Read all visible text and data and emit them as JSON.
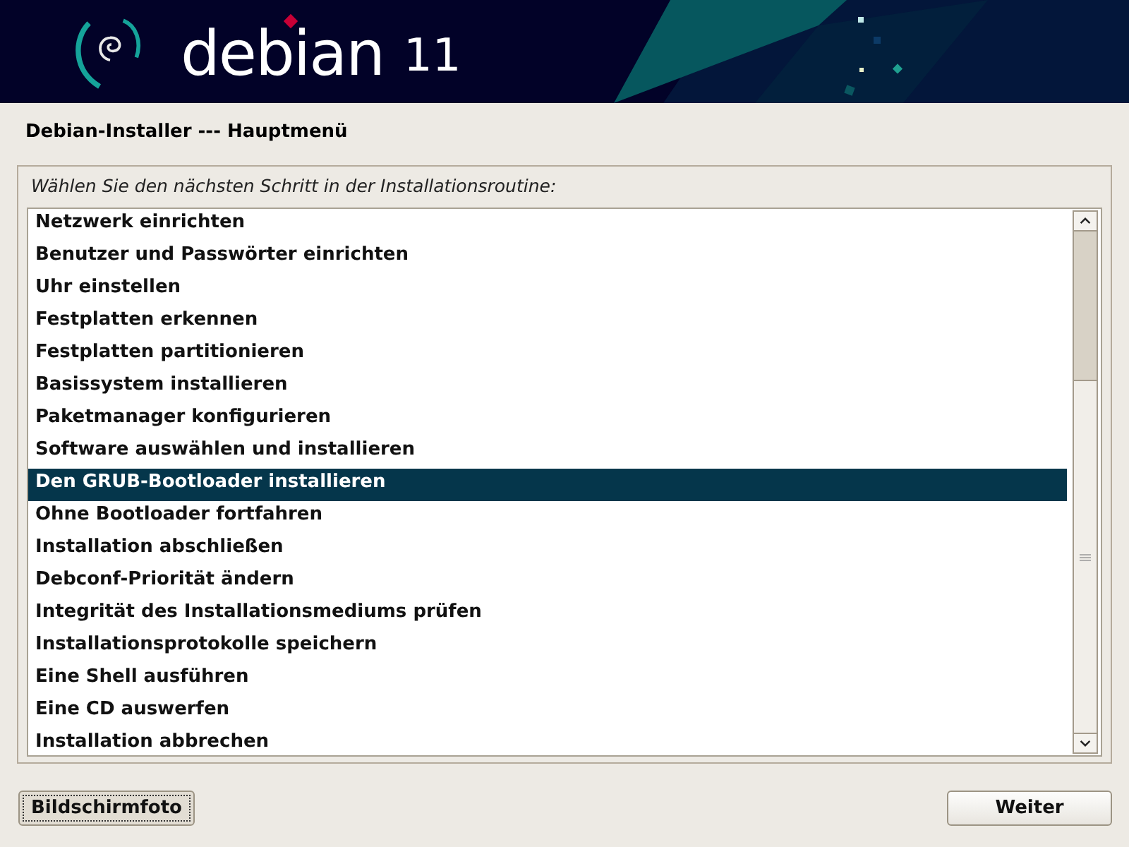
{
  "banner": {
    "logo_text": "debian",
    "version": "11"
  },
  "title": "Debian-Installer --- Hauptmenü",
  "prompt": "Wählen Sie den nächsten Schritt in der Installationsroutine:",
  "items": [
    {
      "label": "Netzwerk einrichten",
      "selected": false
    },
    {
      "label": "Benutzer und Passwörter einrichten",
      "selected": false
    },
    {
      "label": "Uhr einstellen",
      "selected": false
    },
    {
      "label": "Festplatten erkennen",
      "selected": false
    },
    {
      "label": "Festplatten partitionieren",
      "selected": false
    },
    {
      "label": "Basissystem installieren",
      "selected": false
    },
    {
      "label": "Paketmanager konfigurieren",
      "selected": false
    },
    {
      "label": "Software auswählen und installieren",
      "selected": false
    },
    {
      "label": "Den GRUB-Bootloader installieren",
      "selected": true
    },
    {
      "label": "Ohne Bootloader fortfahren",
      "selected": false
    },
    {
      "label": "Installation abschließen",
      "selected": false
    },
    {
      "label": "Debconf-Priorität ändern",
      "selected": false
    },
    {
      "label": "Integrität des Installationsmediums prüfen",
      "selected": false
    },
    {
      "label": "Installationsprotokolle speichern",
      "selected": false
    },
    {
      "label": "Eine Shell ausführen",
      "selected": false
    },
    {
      "label": "Eine CD auswerfen",
      "selected": false
    },
    {
      "label": "Installation abbrechen",
      "selected": false
    }
  ],
  "buttons": [
    {
      "label": "Bildschirmfoto",
      "focused": true
    },
    {
      "label": "Weiter",
      "focused": false
    }
  ]
}
